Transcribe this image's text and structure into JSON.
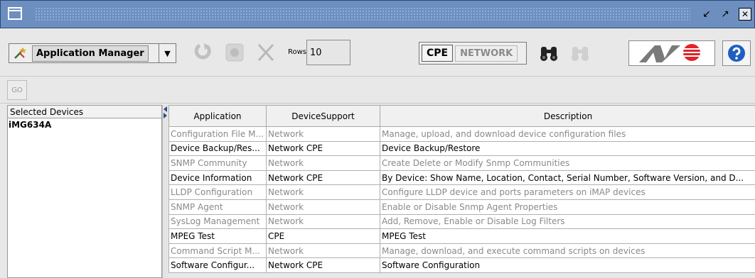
{
  "toolbar": {
    "app_label": "Application Manager",
    "rows_label": "Rows",
    "rows_value": "10",
    "toggle_cpe": "CPE",
    "toggle_network": "NETWORK"
  },
  "go_label": "GO",
  "left_panel": {
    "header": "Selected Devices",
    "items": [
      "iMG634A"
    ]
  },
  "table": {
    "headers": [
      "Application",
      "DeviceSupport",
      "Description"
    ],
    "rows": [
      {
        "app": "Configuration File M...",
        "support": "Network",
        "desc": "Manage, upload, and download device configuration files",
        "enabled": false
      },
      {
        "app": "Device Backup/Res...",
        "support": "Network CPE",
        "desc": "Device Backup/Restore",
        "enabled": true
      },
      {
        "app": "SNMP Community",
        "support": "Network",
        "desc": "Create Delete or Modify Snmp Communities",
        "enabled": false
      },
      {
        "app": "Device Information",
        "support": "Network CPE",
        "desc": "By Device: Show Name, Location, Contact, Serial Number, Software Version, and D...",
        "enabled": true
      },
      {
        "app": "LLDP Configuration",
        "support": "Network",
        "desc": "Configure LLDP device and ports parameters on iMAP devices",
        "enabled": false
      },
      {
        "app": "SNMP Agent",
        "support": "Network",
        "desc": "Enable or Disable Snmp Agent Properties",
        "enabled": false
      },
      {
        "app": "SysLog Management",
        "support": "Network",
        "desc": "Add, Remove, Enable or Disable Log Filters",
        "enabled": false
      },
      {
        "app": "MPEG Test",
        "support": "CPE",
        "desc": "MPEG Test",
        "enabled": true
      },
      {
        "app": "Command Script M...",
        "support": "Network",
        "desc": "Manage, download, and execute command scripts on devices",
        "enabled": false
      },
      {
        "app": "Software Configur...",
        "support": "Network CPE",
        "desc": "Software Configuration",
        "enabled": true
      }
    ]
  },
  "colors": {
    "titlebar": "#6d8fc0",
    "disabled_text": "#8a8a8a",
    "help_blue": "#1f5fbf",
    "logo_red": "#e0242b"
  }
}
